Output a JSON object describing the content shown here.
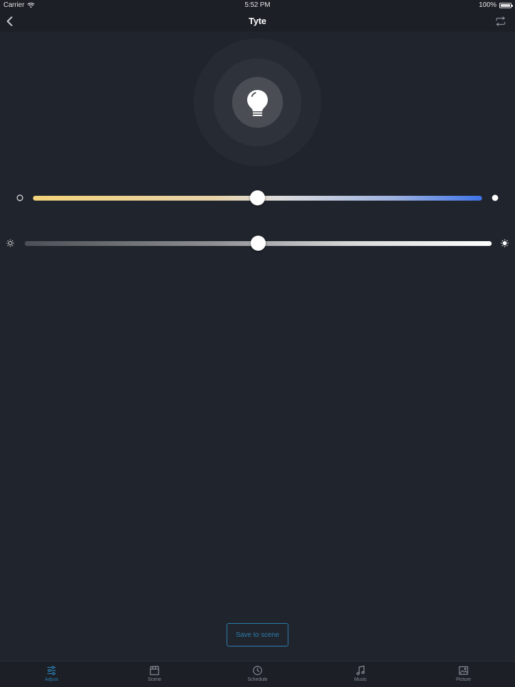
{
  "status_bar": {
    "carrier": "Carrier",
    "time": "5:52 PM",
    "battery": "100%"
  },
  "nav": {
    "title": "Tyte",
    "back_icon": "chevron-left-icon",
    "right_icon": "repeat-icon"
  },
  "bulb": {
    "icon": "lightbulb-icon"
  },
  "sliders": {
    "color_temperature": {
      "value": 0.5,
      "start_icon": "circle-outline-icon",
      "end_icon": "circle-filled-icon",
      "colors": [
        "#f3d37a",
        "#dcdcdc",
        "#3f74e8"
      ]
    },
    "brightness": {
      "value": 0.5,
      "start_icon": "sun-outline-icon",
      "end_icon": "sun-filled-icon",
      "colors": [
        "#4c4f55",
        "#ffffff"
      ]
    }
  },
  "save_button": {
    "label": "Save to scene"
  },
  "tabs": [
    {
      "label": "Adjust",
      "icon": "sliders-icon",
      "active": true
    },
    {
      "label": "Scene",
      "icon": "clapperboard-icon",
      "active": false
    },
    {
      "label": "Schedule",
      "icon": "clock-icon",
      "active": false
    },
    {
      "label": "Music",
      "icon": "music-note-icon",
      "active": false
    },
    {
      "label": "Picture",
      "icon": "picture-icon",
      "active": false
    }
  ],
  "colors": {
    "accent": "#2c7fb0",
    "background": "#20242c",
    "bar": "#1c1f26"
  }
}
